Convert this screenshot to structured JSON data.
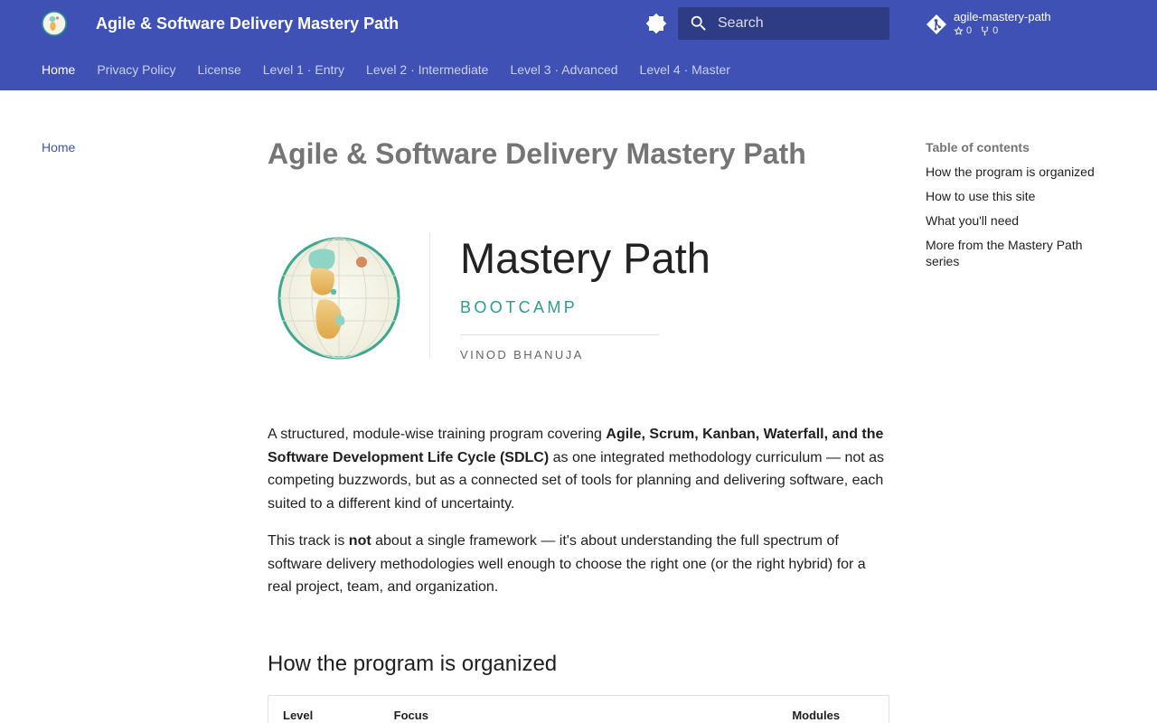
{
  "header": {
    "site_title": "Agile & Software Delivery Mastery Path",
    "search_placeholder": "Search",
    "repo": {
      "name": "agile-mastery-path",
      "stars": "0",
      "forks": "0"
    }
  },
  "tabs": [
    {
      "label": "Home",
      "active": true
    },
    {
      "label": "Privacy Policy"
    },
    {
      "label": "License"
    },
    {
      "label": "Level 1 · Entry"
    },
    {
      "label": "Level 2 · Intermediate"
    },
    {
      "label": "Level 3 · Advanced"
    },
    {
      "label": "Level 4 · Master"
    }
  ],
  "sidebar": {
    "items": [
      {
        "label": "Home"
      }
    ]
  },
  "toc": {
    "title": "Table of contents",
    "items": [
      "How the program is organized",
      "How to use this site",
      "What you'll need",
      "More from the Mastery Path series"
    ]
  },
  "main": {
    "page_title": "Agile & Software Delivery Mastery Path",
    "banner": {
      "title": "Mastery Path",
      "subtitle": "BOOTCAMP",
      "author": "VINOD BHANUJA"
    },
    "p1": {
      "before": "A structured, module-wise training program covering ",
      "bold": "Agile, Scrum, Kanban, Waterfall, and the Software Development Life Cycle (SDLC)",
      "after": " as one integrated methodology curriculum — not as competing buzzwords, but as a connected set of tools for planning and delivering software, each suited to a different kind of uncertainty."
    },
    "p2": {
      "before": "This track is ",
      "bold": "not",
      "after": " about a single framework — it's about understanding the full spectrum of software delivery methodologies well enough to choose the right one (or the right hybrid) for a real project, team, and organization."
    },
    "section_heading": "How the program is organized",
    "table": {
      "headers": [
        "Level",
        "Focus",
        "Modules"
      ]
    }
  },
  "colors": {
    "primary": "#3f51b5",
    "accent_teal": "#2a9d8f",
    "muted_title": "#757575"
  }
}
